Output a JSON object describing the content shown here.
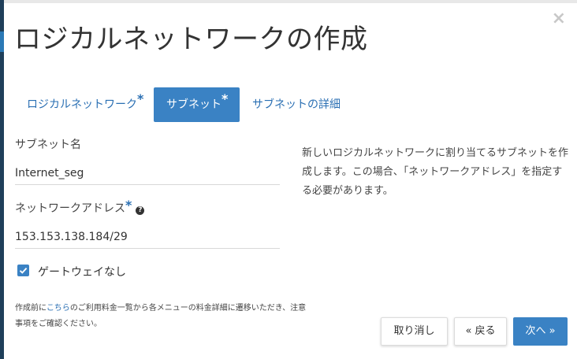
{
  "dialog": {
    "title": "ロジカルネットワークの作成",
    "close_symbol": "×"
  },
  "tabs": [
    {
      "label": "ロジカルネットワーク",
      "required_mark": "*",
      "active": false
    },
    {
      "label": "サブネット",
      "required_mark": "*",
      "active": true
    },
    {
      "label": "サブネットの詳細",
      "required_mark": "",
      "active": false
    }
  ],
  "form": {
    "subnet_name": {
      "label": "サブネット名",
      "value": "Internet_seg"
    },
    "network_address": {
      "label": "ネットワークアドレス",
      "required_mark": "*",
      "help_icon": "?",
      "value": "153.153.138.184/29"
    },
    "no_gateway": {
      "label": "ゲートウェイなし",
      "checked": true
    }
  },
  "description": "新しいロジカルネットワークに割り当てるサブネットを作成します。この場合、「ネットワークアドレス」を指定する必要があります。",
  "note": {
    "before_link": "作成前に",
    "link_text": "こちら",
    "after_link": "のご利用料金一覧から各メニューの料金詳細に遷移いただき、注意事項をご確認ください。"
  },
  "buttons": {
    "cancel": "取り消し",
    "back": "« 戻る",
    "next": "次へ »"
  },
  "colors": {
    "primary": "#3a82c4",
    "link": "#2a6fb3",
    "text": "#333333"
  }
}
